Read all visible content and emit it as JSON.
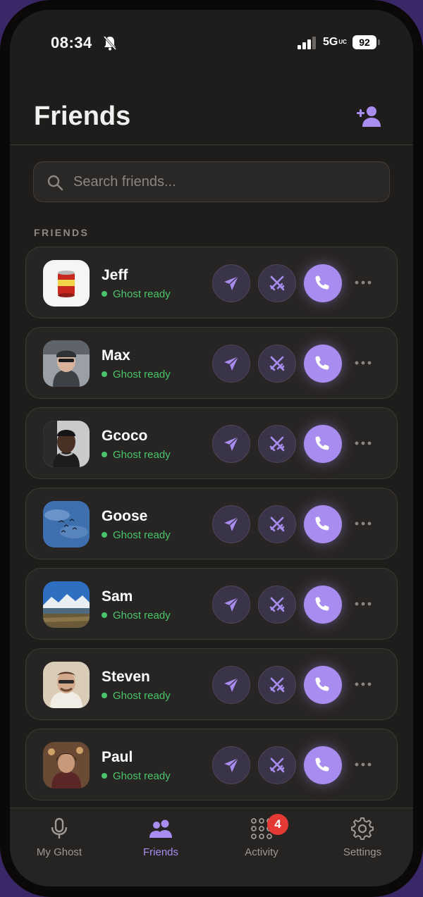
{
  "status_bar": {
    "time": "08:34",
    "network": "5G",
    "network_sub": "UC",
    "battery": "92"
  },
  "header": {
    "title": "Friends"
  },
  "search": {
    "placeholder": "Search friends..."
  },
  "section": {
    "label": "FRIENDS"
  },
  "friends": [
    {
      "name": "Jeff",
      "status": "Ghost ready"
    },
    {
      "name": "Max",
      "status": "Ghost ready"
    },
    {
      "name": "Gcoco",
      "status": "Ghost ready"
    },
    {
      "name": "Goose",
      "status": "Ghost ready"
    },
    {
      "name": "Sam",
      "status": "Ghost ready"
    },
    {
      "name": "Steven",
      "status": "Ghost ready"
    },
    {
      "name": "Paul",
      "status": "Ghost ready"
    }
  ],
  "tabs": [
    {
      "label": "My Ghost",
      "icon": "microphone-icon"
    },
    {
      "label": "Friends",
      "icon": "users-icon",
      "active": true
    },
    {
      "label": "Activity",
      "icon": "grid-dots-icon",
      "badge": "4"
    },
    {
      "label": "Settings",
      "icon": "gear-icon"
    }
  ],
  "colors": {
    "accent": "#a98cf0",
    "status_green": "#49c46a",
    "badge_red": "#e53935",
    "background": "#1f1d1b"
  }
}
